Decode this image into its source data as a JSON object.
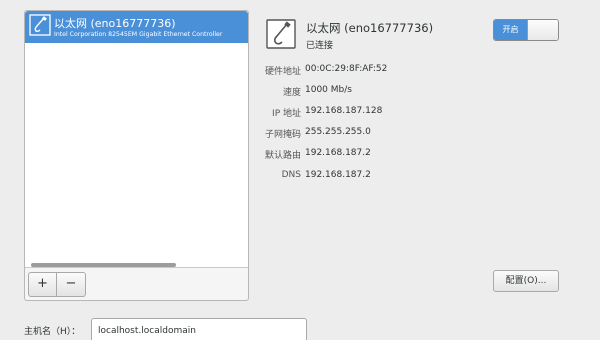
{
  "connection_list": {
    "items": [
      {
        "name": "以太网 (eno16777736)",
        "detail": "Intel Corporation 82545EM Gigabit Ethernet Controller",
        "icon": "ethernet-cable-icon"
      }
    ],
    "add_label": "+",
    "remove_label": "−"
  },
  "details": {
    "icon": "ethernet-cable-icon",
    "name": "以太网 (eno16777736)",
    "status": "已连接",
    "toggle_label": "开启",
    "properties": [
      {
        "label": "硬件地址",
        "value": "00:0C:29:8F:AF:52"
      },
      {
        "label": "速度",
        "value": "1000 Mb/s"
      },
      {
        "label": "IP 地址",
        "value": "192.168.187.128"
      },
      {
        "label": "子网掩码",
        "value": "255.255.255.0"
      },
      {
        "label": "默认路由",
        "value": "192.168.187.2"
      },
      {
        "label": "DNS",
        "value": "192.168.187.2"
      }
    ],
    "configure_label": "配置(O)..."
  },
  "hostname": {
    "label": "主机名（H）：",
    "value": "localhost.localdomain"
  },
  "colors": {
    "selection": "#4a90d9",
    "background": "#ededed"
  }
}
